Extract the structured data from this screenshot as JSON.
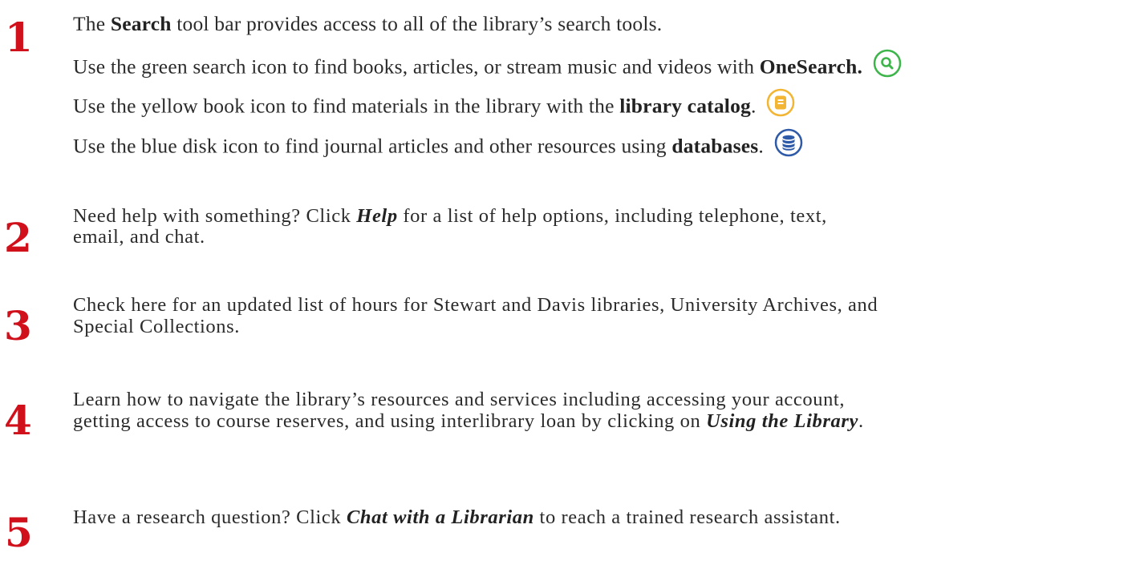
{
  "item1": {
    "number": "1",
    "line1": {
      "a": "The ",
      "b": "Search",
      "c": " tool bar provides access to all of the library’s search tools."
    },
    "line2": {
      "a": "Use the green search icon to find books, articles, or stream music and videos with ",
      "b": "OneSearch."
    },
    "line3": {
      "a": "Use the yellow book icon to find materials in the library with the ",
      "b": "library catalog",
      "c": "."
    },
    "line4": {
      "a": "Use the blue disk icon to find journal articles and other resources using ",
      "b": "databases",
      "c": "."
    },
    "icons": {
      "green": {
        "name": "search-icon",
        "color": "#3db54a"
      },
      "yellow": {
        "name": "book-icon",
        "color": "#f2b534"
      },
      "blue": {
        "name": "database-icon",
        "color": "#2e5aa8"
      }
    }
  },
  "item2": {
    "number": "2",
    "line1": {
      "a": "Need help with something? Click ",
      "b": "Help",
      "c": " for a list of help options, including telephone, text,"
    },
    "line2": "email, and chat."
  },
  "item3": {
    "number": "3",
    "line1": "Check here for an updated list of hours for Stewart and Davis libraries, University Archives, and",
    "line2": "Special Collections."
  },
  "item4": {
    "number": "4",
    "line1": "Learn how to navigate the library’s resources and services including accessing your account,",
    "line2": {
      "a": "getting access to course reserves, and using interlibrary loan by clicking on ",
      "b": "Using the Library",
      "c": "."
    }
  },
  "item5": {
    "number": "5",
    "line1": {
      "a": "Have a research question? Click ",
      "b": "Chat with a Librarian",
      "c": " to reach a trained research assistant."
    }
  },
  "colors": {
    "number_red": "#d0111b",
    "text": "#2b2b2b"
  }
}
